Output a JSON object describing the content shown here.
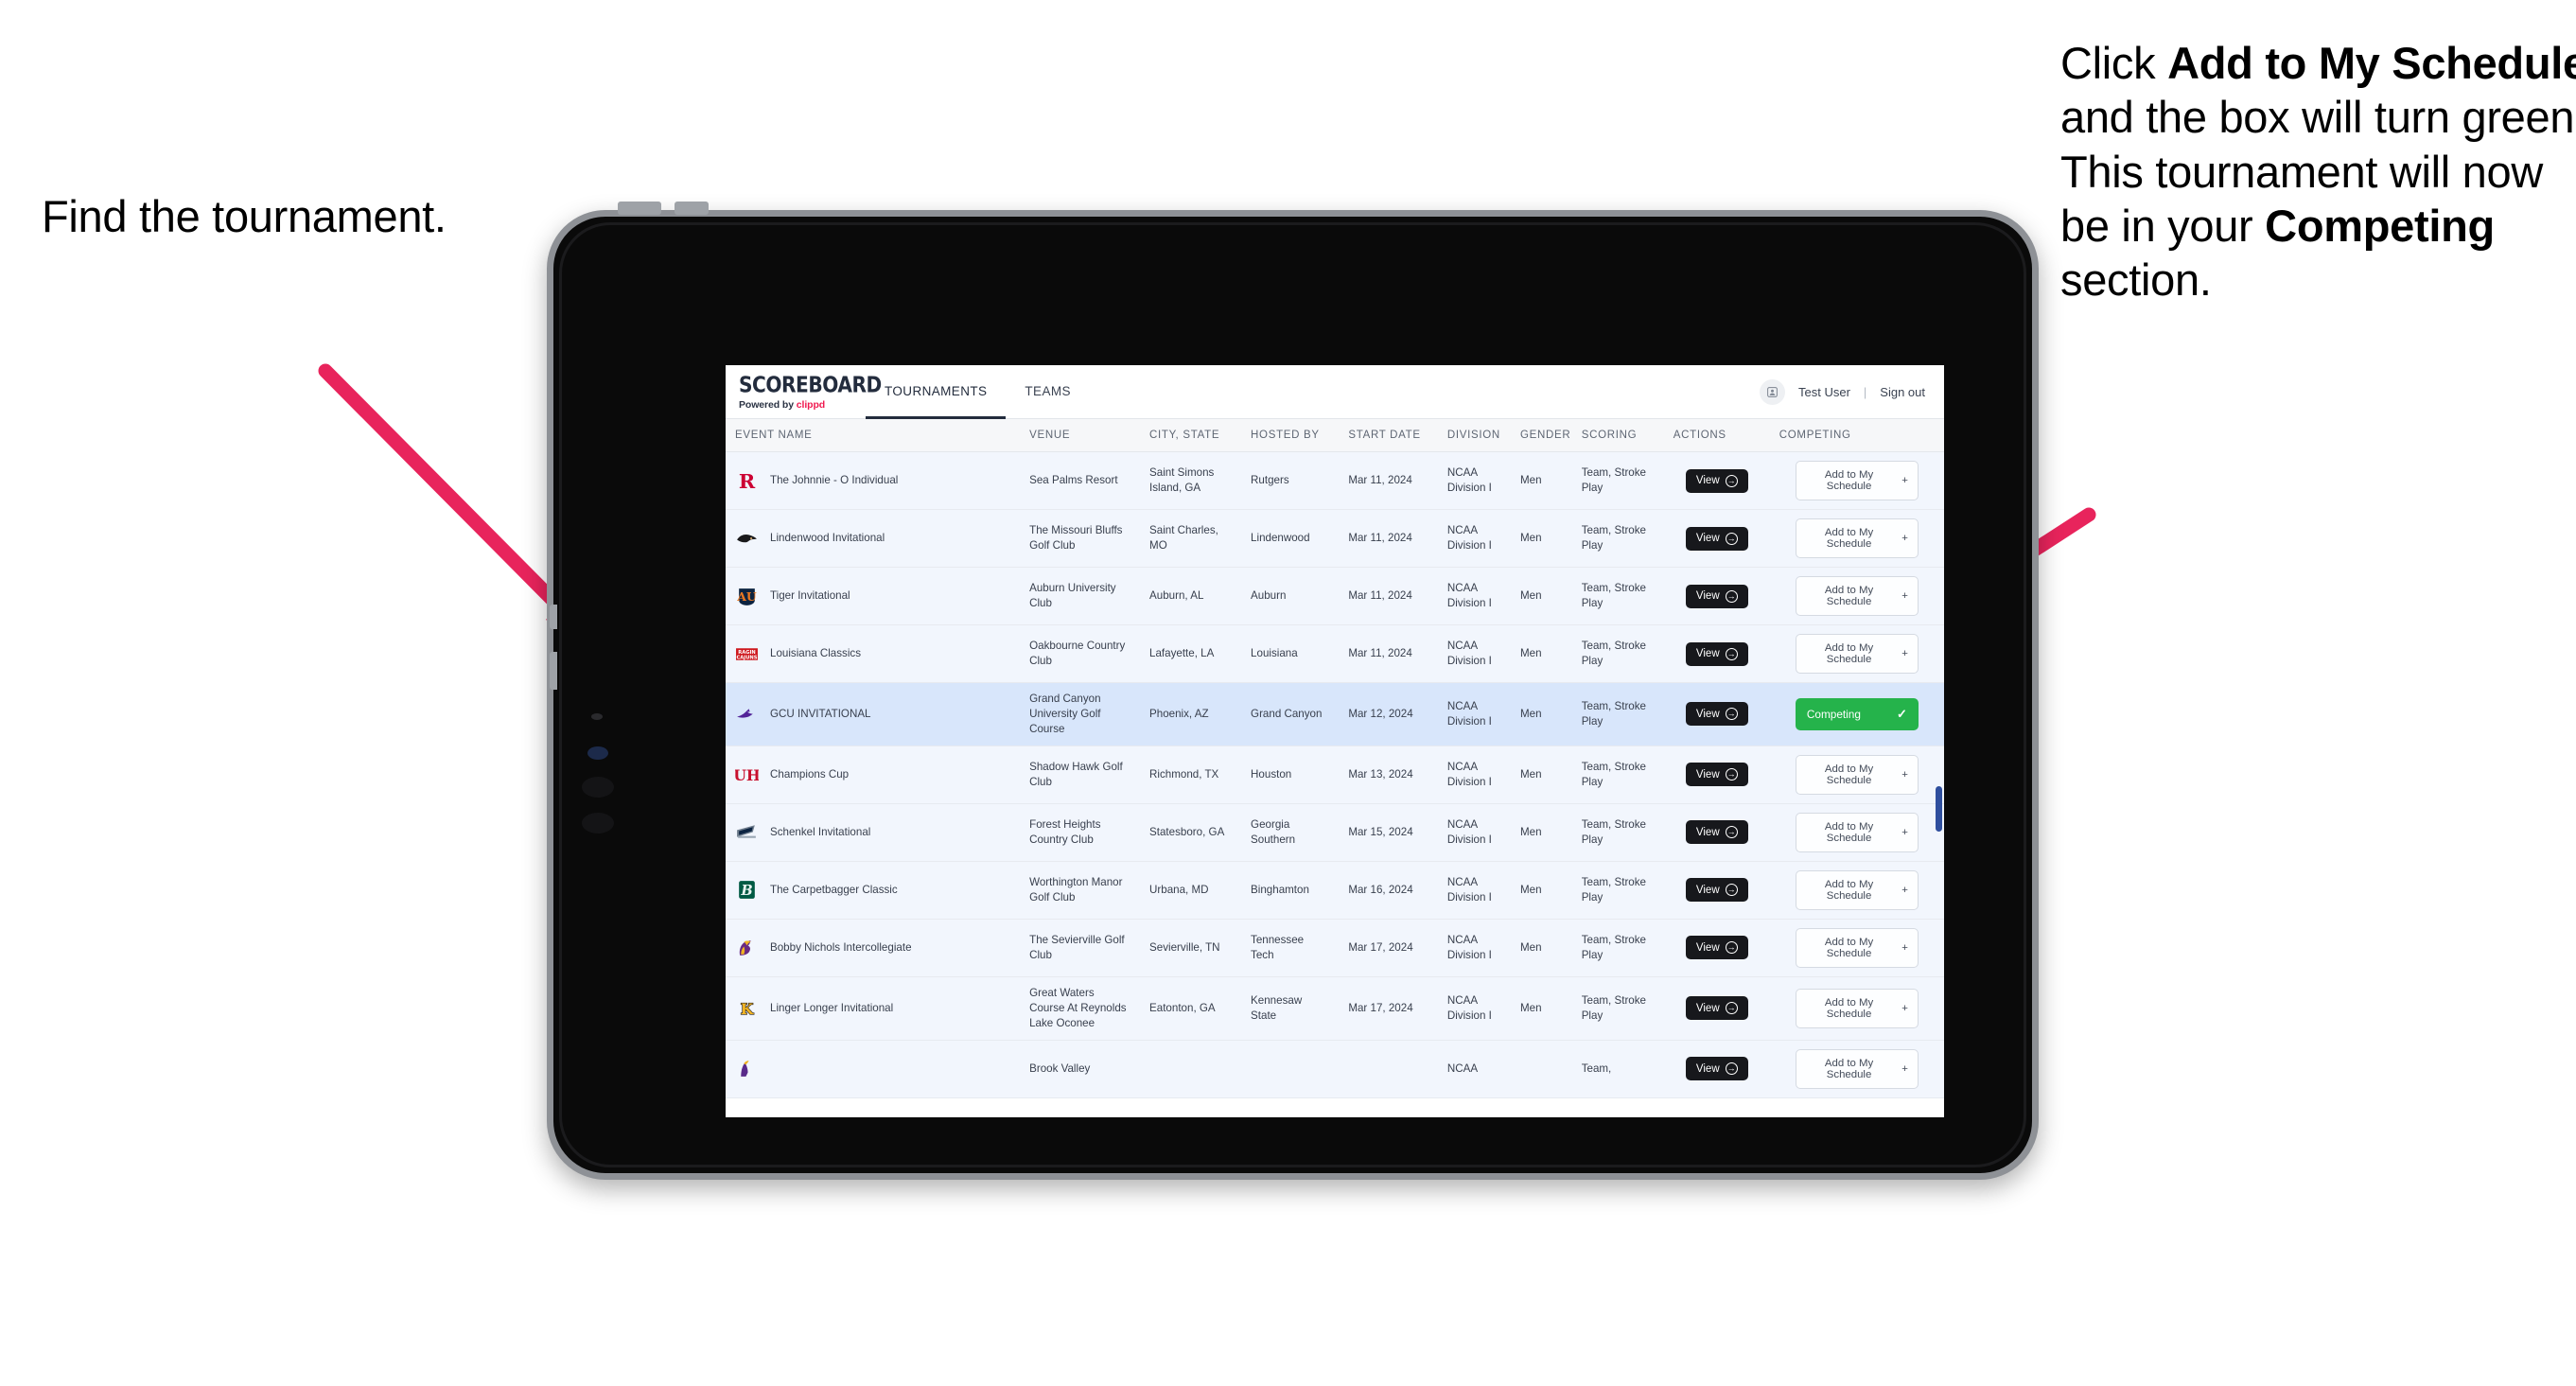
{
  "annotations": {
    "left": {
      "text": "Find the tournament."
    },
    "right": {
      "l1_plain": "Click ",
      "l1_bold": "Add to My Schedule",
      "l2_plain": " and the box will turn green. This tournament will now be in your ",
      "l2_bold": "Competing",
      "l3_plain": " section."
    },
    "arrow_color": "#E8245C"
  },
  "browser": {
    "brand": {
      "word": "SCOREBOARD",
      "powered_prefix": "Powered by ",
      "powered_brand": "clippd"
    },
    "nav": [
      {
        "label": "TOURNAMENTS",
        "active": true
      },
      {
        "label": "TEAMS",
        "active": false
      }
    ],
    "user": {
      "name": "Test User",
      "divider": "|",
      "signout": "Sign out",
      "avatar_icon": "user-avatar-icon"
    }
  },
  "table": {
    "columns": [
      "EVENT NAME",
      "VENUE",
      "CITY, STATE",
      "HOSTED BY",
      "START DATE",
      "DIVISION",
      "GENDER",
      "SCORING",
      "ACTIONS",
      "COMPETING"
    ],
    "action_label": "View",
    "add_label": "Add to My Schedule",
    "add_icon": "plus-icon",
    "competing_label": "Competing",
    "competing_icon": "check-icon",
    "competing_color": "#25b34b",
    "rows": [
      {
        "logo": "rutgers",
        "event": "The Johnnie - O Individual",
        "venue": "Sea Palms Resort",
        "city": "Saint Simons Island, GA",
        "hosted": "Rutgers",
        "date": "Mar 11, 2024",
        "division": "NCAA Division I",
        "gender": "Men",
        "scoring": "Team, Stroke Play",
        "competing": false
      },
      {
        "logo": "lindenwood",
        "event": "Lindenwood Invitational",
        "venue": "The Missouri Bluffs Golf Club",
        "city": "Saint Charles, MO",
        "hosted": "Lindenwood",
        "date": "Mar 11, 2024",
        "division": "NCAA Division I",
        "gender": "Men",
        "scoring": "Team, Stroke Play",
        "competing": false
      },
      {
        "logo": "auburn",
        "event": "Tiger Invitational",
        "venue": "Auburn University Club",
        "city": "Auburn, AL",
        "hosted": "Auburn",
        "date": "Mar 11, 2024",
        "division": "NCAA Division I",
        "gender": "Men",
        "scoring": "Team, Stroke Play",
        "competing": false
      },
      {
        "logo": "louisiana",
        "event": "Louisiana Classics",
        "venue": "Oakbourne Country Club",
        "city": "Lafayette, LA",
        "hosted": "Louisiana",
        "date": "Mar 11, 2024",
        "division": "NCAA Division I",
        "gender": "Men",
        "scoring": "Team, Stroke Play",
        "competing": false
      },
      {
        "logo": "gcu",
        "event": "GCU INVITATIONAL",
        "venue": "Grand Canyon University Golf Course",
        "city": "Phoenix, AZ",
        "hosted": "Grand Canyon",
        "date": "Mar 12, 2024",
        "division": "NCAA Division I",
        "gender": "Men",
        "scoring": "Team, Stroke Play",
        "competing": true
      },
      {
        "logo": "houston",
        "event": "Champions Cup",
        "venue": "Shadow Hawk Golf Club",
        "city": "Richmond, TX",
        "hosted": "Houston",
        "date": "Mar 13, 2024",
        "division": "NCAA Division I",
        "gender": "Men",
        "scoring": "Team, Stroke Play",
        "competing": false
      },
      {
        "logo": "gasouthern",
        "event": "Schenkel Invitational",
        "venue": "Forest Heights Country Club",
        "city": "Statesboro, GA",
        "hosted": "Georgia Southern",
        "date": "Mar 15, 2024",
        "division": "NCAA Division I",
        "gender": "Men",
        "scoring": "Team, Stroke Play",
        "competing": false
      },
      {
        "logo": "binghamton",
        "event": "The Carpetbagger Classic",
        "venue": "Worthington Manor Golf Club",
        "city": "Urbana, MD",
        "hosted": "Binghamton",
        "date": "Mar 16, 2024",
        "division": "NCAA Division I",
        "gender": "Men",
        "scoring": "Team, Stroke Play",
        "competing": false
      },
      {
        "logo": "tntech",
        "event": "Bobby Nichols Intercollegiate",
        "venue": "The Sevierville Golf Club",
        "city": "Sevierville, TN",
        "hosted": "Tennessee Tech",
        "date": "Mar 17, 2024",
        "division": "NCAA Division I",
        "gender": "Men",
        "scoring": "Team, Stroke Play",
        "competing": false
      },
      {
        "logo": "kennesaw",
        "event": "Linger Longer Invitational",
        "venue": "Great Waters Course At Reynolds Lake Oconee",
        "city": "Eatonton, GA",
        "hosted": "Kennesaw State",
        "date": "Mar 17, 2024",
        "division": "NCAA Division I",
        "gender": "Men",
        "scoring": "Team, Stroke Play",
        "competing": false
      },
      {
        "logo": "ecu",
        "event": "",
        "venue": "Brook Valley",
        "city": "",
        "hosted": "",
        "date": "",
        "division": "NCAA",
        "gender": "",
        "scoring": "Team,",
        "competing": false
      }
    ]
  }
}
